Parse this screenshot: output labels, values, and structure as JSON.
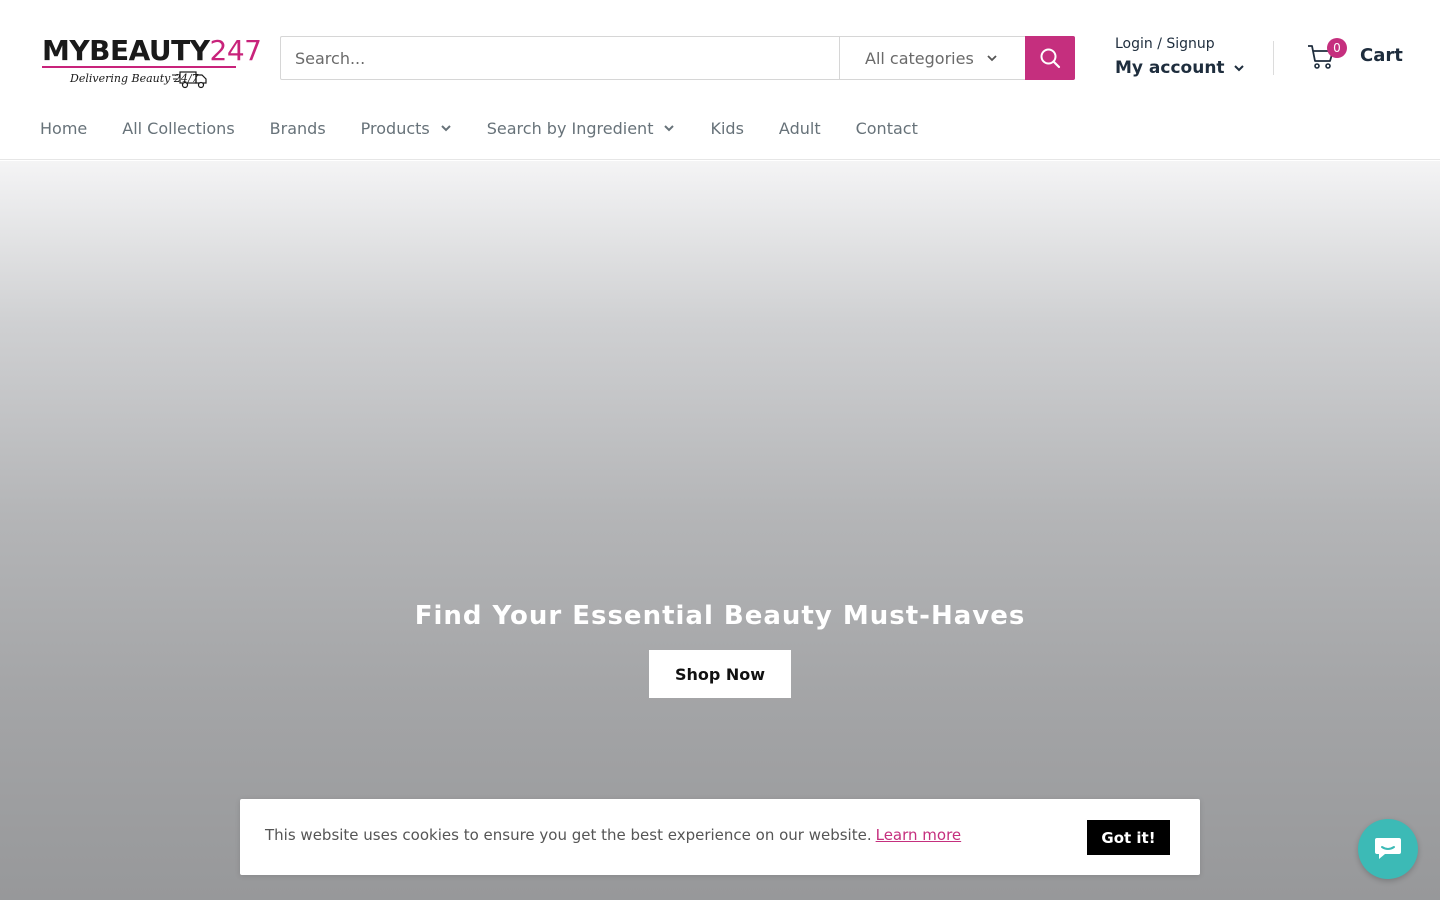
{
  "logo": {
    "brand_main": "MYBEAUTY",
    "brand_number": "247",
    "tagline": "Delivering Beauty 24/7"
  },
  "search": {
    "placeholder": "Search...",
    "category_selected": "All categories",
    "button_icon": "search-icon"
  },
  "account": {
    "login_label": "Login / Signup",
    "account_label": "My account"
  },
  "cart": {
    "count": "0",
    "label": "Cart"
  },
  "nav": {
    "items": [
      {
        "label": "Home"
      },
      {
        "label": "All Collections"
      },
      {
        "label": "Brands"
      },
      {
        "label": "Products"
      },
      {
        "label": "Search by Ingredient"
      },
      {
        "label": "Kids"
      },
      {
        "label": "Adult"
      },
      {
        "label": "Contact"
      }
    ]
  },
  "hero": {
    "title": "Find Your Essential Beauty Must-Haves",
    "cta_label": "Shop Now"
  },
  "cookie": {
    "message": "This website uses cookies to ensure you get the best experience on our website.",
    "link_label": "Learn more",
    "button_label": "Got it!"
  },
  "chat": {
    "icon": "chat-bubble-icon"
  },
  "colors": {
    "accent": "#c52f7e",
    "text_dark": "#1e2d3d",
    "nav_text": "#677279",
    "chat_bg": "#3cbab6"
  }
}
